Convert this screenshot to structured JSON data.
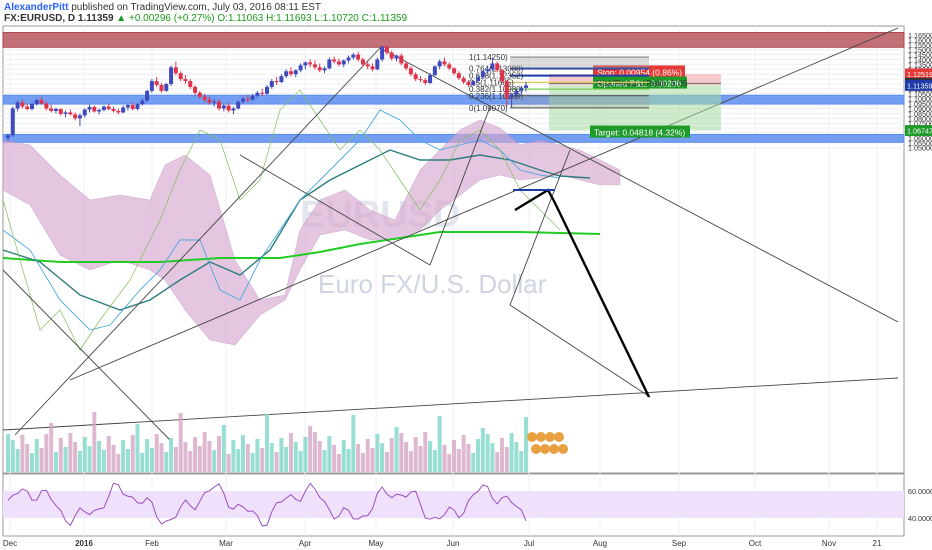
{
  "header": {
    "author": "AlexanderPitt",
    "published_text": "published on TradingView.com, July 03, 2016 08:11 EST",
    "symbol": "FX:EURUSD, D",
    "last": "1.11359",
    "change": "+0.00296 (+0.27%)",
    "o": "O:1.11063",
    "h": "H:1.11693",
    "l": "L:1.10720",
    "c": "C:1.11359"
  },
  "watermark": {
    "symbol": "EURUSD",
    "name": "Euro FX/U.S. Dollar"
  },
  "colors": {
    "up": "#3f4bbd",
    "down": "#e0334b",
    "resistance_zone": "#b0404a",
    "support_zone": "#5b8df0",
    "kumo": "#c79ac7",
    "ma_green": "#22cc22",
    "rsi_bg": "#efe0fb"
  },
  "chart_data": {
    "type": "candlestick",
    "title": "",
    "xlabel": "",
    "ylabel": "",
    "price_axis": {
      "ticks": [
        "1.16500",
        "1.16000",
        "1.15500",
        "1.15000",
        "1.14500",
        "1.14000",
        "1.13500",
        "1.13000",
        "1.12500",
        "1.12000",
        "1.11500",
        "1.11000",
        "1.10500",
        "1.10000",
        "1.09500",
        "1.09000",
        "1.08500",
        "1.08000",
        "1.07500",
        "1.07000",
        "1.06500",
        "1.06000",
        "1.05500",
        "1.05000"
      ],
      "ylim": [
        1.0475,
        1.1685
      ]
    },
    "time_axis": {
      "labels": [
        "Dec",
        "2016",
        "Feb",
        "Mar",
        "Apr",
        "May",
        "Jun",
        "Jul",
        "Aug",
        "Sep",
        "Oct",
        "Nov",
        "21"
      ]
    },
    "price_badges": [
      {
        "value": "1.12519",
        "kind": "stop"
      },
      {
        "value": "1.11565",
        "kind": "current"
      },
      {
        "value": "1.11359",
        "kind": "last"
      },
      {
        "value": "1.06747",
        "kind": "target"
      }
    ],
    "fibonacci": [
      {
        "label": "1(1.14250)",
        "price": 1.1425
      },
      {
        "label": "0.764(1.13080)",
        "price": 1.1308
      },
      {
        "label": "0.618(1.12352)",
        "price": 1.12352
      },
      {
        "label": "0.5(1.11665)",
        "price": 1.11665
      },
      {
        "label": "0.382(1.10980)",
        "price": 1.1098
      },
      {
        "label": "0.236(1.10299)",
        "price": 1.10299
      },
      {
        "label": "0(1.09070)",
        "price": 1.0907
      }
    ],
    "position": {
      "stop_label": "Stop: 0.00954 (0.86%)",
      "pnl_label": "Opened P&L: 0.00206",
      "rr_label": "Risk/Reward Ratio: 5.05",
      "target_label": "Target: 0.04818 (4.32%)"
    },
    "zones": [
      {
        "name": "resistance",
        "from": 1.1525,
        "to": 1.1675
      },
      {
        "name": "support-mid",
        "from": 1.0945,
        "to": 1.1035
      },
      {
        "name": "support-low",
        "from": 1.0555,
        "to": 1.0635
      }
    ],
    "rsi": {
      "ticks": [
        "60.0000",
        "40.0000"
      ],
      "ylim": [
        30,
        70
      ]
    },
    "candles": [
      [
        1.06,
        1.064,
        1.057,
        1.0625
      ],
      [
        1.0625,
        1.092,
        1.061,
        1.09
      ],
      [
        1.09,
        1.098,
        1.087,
        1.096
      ],
      [
        1.096,
        1.099,
        1.09,
        1.092
      ],
      [
        1.092,
        1.095,
        1.088,
        1.0895
      ],
      [
        1.0895,
        1.096,
        1.088,
        1.0945
      ],
      [
        1.0945,
        1.1,
        1.093,
        1.0985
      ],
      [
        1.0985,
        1.102,
        1.094,
        1.095
      ],
      [
        1.095,
        1.097,
        1.088,
        1.09
      ],
      [
        1.09,
        1.094,
        1.086,
        1.0875
      ],
      [
        1.0875,
        1.091,
        1.085,
        1.0895
      ],
      [
        1.0895,
        1.09,
        1.083,
        1.0845
      ],
      [
        1.0845,
        1.088,
        1.081,
        1.086
      ],
      [
        1.086,
        1.089,
        1.083,
        1.084
      ],
      [
        1.084,
        1.086,
        1.078,
        1.08
      ],
      [
        1.08,
        1.085,
        1.072,
        1.083
      ],
      [
        1.083,
        1.09,
        1.081,
        1.089
      ],
      [
        1.089,
        1.094,
        1.086,
        1.0915
      ],
      [
        1.0915,
        1.093,
        1.086,
        1.087
      ],
      [
        1.087,
        1.09,
        1.084,
        1.0885
      ],
      [
        1.0885,
        1.093,
        1.087,
        1.092
      ],
      [
        1.092,
        1.095,
        1.088,
        1.0895
      ],
      [
        1.0895,
        1.092,
        1.086,
        1.0875
      ],
      [
        1.0875,
        1.09,
        1.084,
        1.086
      ],
      [
        1.086,
        1.093,
        1.085,
        1.091
      ],
      [
        1.091,
        1.095,
        1.088,
        1.0935
      ],
      [
        1.0935,
        1.096,
        1.088,
        1.0895
      ],
      [
        1.0895,
        1.096,
        1.088,
        1.0945
      ],
      [
        1.0945,
        1.1,
        1.093,
        1.098
      ],
      [
        1.098,
        1.109,
        1.097,
        1.108
      ],
      [
        1.108,
        1.12,
        1.106,
        1.118
      ],
      [
        1.118,
        1.122,
        1.112,
        1.114
      ],
      [
        1.114,
        1.116,
        1.106,
        1.108
      ],
      [
        1.108,
        1.116,
        1.107,
        1.115
      ],
      [
        1.115,
        1.134,
        1.113,
        1.132
      ],
      [
        1.132,
        1.138,
        1.124,
        1.126
      ],
      [
        1.126,
        1.128,
        1.118,
        1.12
      ],
      [
        1.12,
        1.124,
        1.115,
        1.118
      ],
      [
        1.118,
        1.12,
        1.11,
        1.112
      ],
      [
        1.112,
        1.114,
        1.104,
        1.106
      ],
      [
        1.106,
        1.108,
        1.1,
        1.102
      ],
      [
        1.102,
        1.105,
        1.096,
        1.099
      ],
      [
        1.099,
        1.102,
        1.094,
        1.096
      ],
      [
        1.096,
        1.1,
        1.092,
        1.097
      ],
      [
        1.097,
        1.099,
        1.088,
        1.09
      ],
      [
        1.09,
        1.095,
        1.087,
        1.093
      ],
      [
        1.093,
        1.096,
        1.086,
        1.088
      ],
      [
        1.088,
        1.092,
        1.084,
        1.09
      ],
      [
        1.09,
        1.098,
        1.089,
        1.097
      ],
      [
        1.097,
        1.102,
        1.095,
        1.1
      ],
      [
        1.1,
        1.104,
        1.096,
        1.099
      ],
      [
        1.099,
        1.105,
        1.098,
        1.103
      ],
      [
        1.103,
        1.108,
        1.101,
        1.106
      ],
      [
        1.106,
        1.11,
        1.103,
        1.105
      ],
      [
        1.105,
        1.114,
        1.104,
        1.112
      ],
      [
        1.112,
        1.12,
        1.11,
        1.118
      ],
      [
        1.118,
        1.122,
        1.114,
        1.117
      ],
      [
        1.117,
        1.125,
        1.116,
        1.123
      ],
      [
        1.123,
        1.13,
        1.121,
        1.128
      ],
      [
        1.128,
        1.132,
        1.123,
        1.125
      ],
      [
        1.125,
        1.13,
        1.122,
        1.129
      ],
      [
        1.129,
        1.136,
        1.127,
        1.134
      ],
      [
        1.134,
        1.138,
        1.13,
        1.137
      ],
      [
        1.137,
        1.14,
        1.132,
        1.135
      ],
      [
        1.135,
        1.139,
        1.13,
        1.132
      ],
      [
        1.132,
        1.136,
        1.127,
        1.129
      ],
      [
        1.129,
        1.133,
        1.126,
        1.131
      ],
      [
        1.131,
        1.142,
        1.13,
        1.14
      ],
      [
        1.14,
        1.143,
        1.136,
        1.138
      ],
      [
        1.138,
        1.141,
        1.133,
        1.135
      ],
      [
        1.135,
        1.14,
        1.132,
        1.139
      ],
      [
        1.139,
        1.144,
        1.136,
        1.142
      ],
      [
        1.142,
        1.147,
        1.14,
        1.145
      ],
      [
        1.145,
        1.148,
        1.138,
        1.14
      ],
      [
        1.14,
        1.142,
        1.133,
        1.135
      ],
      [
        1.135,
        1.138,
        1.13,
        1.133
      ],
      [
        1.133,
        1.136,
        1.128,
        1.13
      ],
      [
        1.13,
        1.142,
        1.129,
        1.14
      ],
      [
        1.14,
        1.154,
        1.138,
        1.153
      ],
      [
        1.153,
        1.154,
        1.145,
        1.147
      ],
      [
        1.147,
        1.149,
        1.139,
        1.141
      ],
      [
        1.141,
        1.145,
        1.138,
        1.144
      ],
      [
        1.144,
        1.146,
        1.134,
        1.136
      ],
      [
        1.136,
        1.138,
        1.129,
        1.131
      ],
      [
        1.131,
        1.133,
        1.123,
        1.125
      ],
      [
        1.125,
        1.127,
        1.118,
        1.12
      ],
      [
        1.12,
        1.123,
        1.117,
        1.119
      ],
      [
        1.119,
        1.121,
        1.114,
        1.116
      ],
      [
        1.116,
        1.126,
        1.115,
        1.124
      ],
      [
        1.124,
        1.134,
        1.123,
        1.133
      ],
      [
        1.133,
        1.14,
        1.13,
        1.138
      ],
      [
        1.138,
        1.142,
        1.133,
        1.135
      ],
      [
        1.135,
        1.137,
        1.129,
        1.131
      ],
      [
        1.131,
        1.132,
        1.124,
        1.126
      ],
      [
        1.126,
        1.128,
        1.119,
        1.121
      ],
      [
        1.121,
        1.123,
        1.115,
        1.117
      ],
      [
        1.117,
        1.119,
        1.112,
        1.114
      ],
      [
        1.114,
        1.119,
        1.113,
        1.118
      ],
      [
        1.118,
        1.124,
        1.117,
        1.122
      ],
      [
        1.122,
        1.129,
        1.121,
        1.128
      ],
      [
        1.128,
        1.133,
        1.125,
        1.13
      ],
      [
        1.13,
        1.142,
        1.128,
        1.136
      ],
      [
        1.136,
        1.138,
        1.127,
        1.129
      ],
      [
        1.129,
        1.131,
        1.116,
        1.118
      ],
      [
        1.118,
        1.119,
        1.092,
        1.101
      ],
      [
        1.101,
        1.106,
        1.091,
        1.104
      ],
      [
        1.104,
        1.11,
        1.099,
        1.108
      ],
      [
        1.108,
        1.113,
        1.104,
        1.111
      ],
      [
        1.111,
        1.117,
        1.1072,
        1.1136
      ]
    ]
  }
}
